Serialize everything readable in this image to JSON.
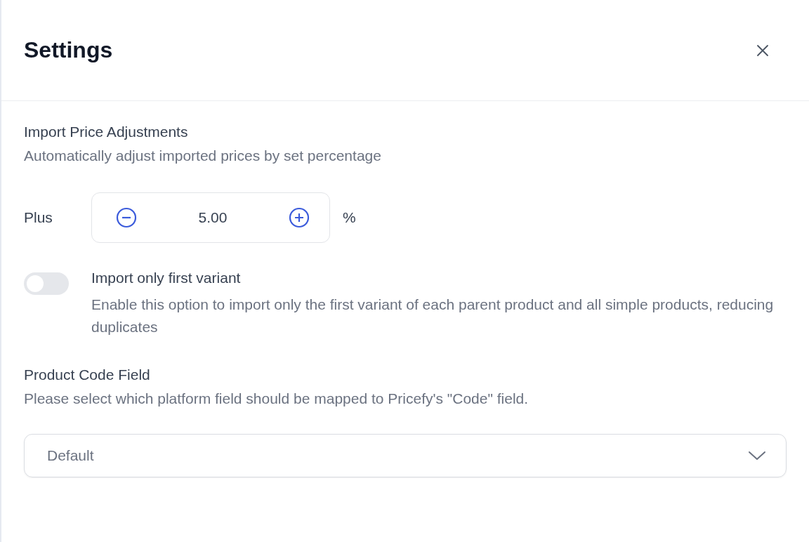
{
  "panel": {
    "title": "Settings"
  },
  "price_adjustments": {
    "heading": "Import Price Adjustments",
    "description": "Automatically adjust imported prices by set percentage",
    "mode_label": "Plus",
    "value": "5.00",
    "unit": "%"
  },
  "first_variant": {
    "on": false,
    "label": "Import only first variant",
    "description": "Enable this option to import only the first variant of each parent product and all simple products, reducing duplicates"
  },
  "product_code": {
    "heading": "Product Code Field",
    "description": "Please select which platform field should be mapped to Pricefy's \"Code\" field.",
    "selected_value": "Default"
  }
}
